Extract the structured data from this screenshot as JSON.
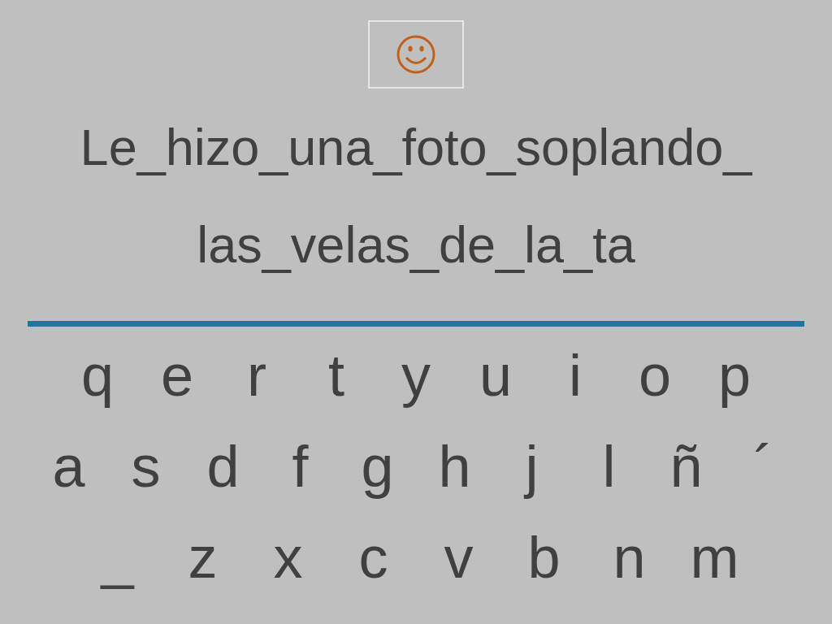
{
  "sentence": [
    "Le_hizo_una_foto_soplando_",
    "las_velas_de_la_ta"
  ],
  "keyboard": [
    [
      "q",
      "e",
      "r",
      "t",
      "y",
      "u",
      "i",
      "o",
      "p"
    ],
    [
      "a",
      "s",
      "d",
      "f",
      "g",
      "h",
      "j",
      "l",
      "ñ",
      "´"
    ],
    [
      "_",
      "z",
      "x",
      "c",
      "v",
      "b",
      "n",
      "m"
    ]
  ]
}
